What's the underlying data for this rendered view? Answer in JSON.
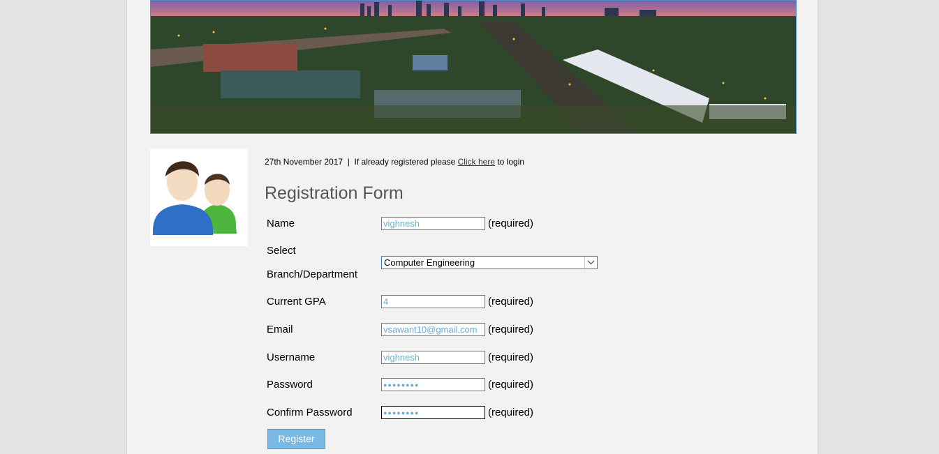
{
  "header": {
    "date": "27th November 2017",
    "separator": "|",
    "login_prompt_prefix": "If already registered please",
    "login_link": "Click here",
    "login_prompt_suffix": "to login"
  },
  "form": {
    "title": "Registration Form",
    "required_text": "(required)",
    "name": {
      "label": "Name",
      "value": "vighnesh"
    },
    "branch": {
      "label_line1": "Select",
      "label_line2": "Branch/Department",
      "selected": "Computer Engineering"
    },
    "gpa": {
      "label": "Current GPA",
      "value": "4"
    },
    "email": {
      "label": "Email",
      "value": "vsawant10@gmail.com"
    },
    "username": {
      "label": "Username",
      "value": "vighnesh"
    },
    "password": {
      "label": "Password",
      "value": "●●●●●●●●"
    },
    "confirm_password": {
      "label": "Confirm Password",
      "value": "●●●●●●●●"
    },
    "register_label": "Register"
  },
  "colors": {
    "accent": "#7ab9e3",
    "input_text": "#6aaed6",
    "banner_border": "#4a8ecf"
  },
  "icons": {
    "select_arrow": "chevron-down-icon",
    "avatar": "users-avatar-icon"
  }
}
